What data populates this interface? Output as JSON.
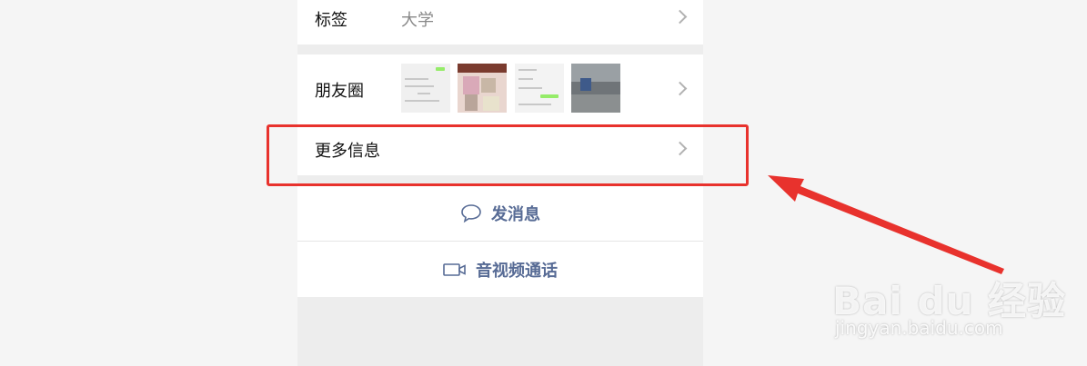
{
  "profile": {
    "tag_row": {
      "label": "标签",
      "value": "大学"
    },
    "moments_row": {
      "label": "朋友圈"
    },
    "more_info_row": {
      "label": "更多信息"
    }
  },
  "actions": {
    "send_message_label": "发消息",
    "av_call_label": "音视频通话"
  },
  "annotation": {
    "highlight_color": "#e8322d",
    "arrow_color": "#e8322d"
  },
  "watermark": {
    "logo": "Bai du 经验",
    "url": "jingyan.baidu.com"
  },
  "colors": {
    "link_blue": "#576b95",
    "page_bg": "#ededed"
  }
}
